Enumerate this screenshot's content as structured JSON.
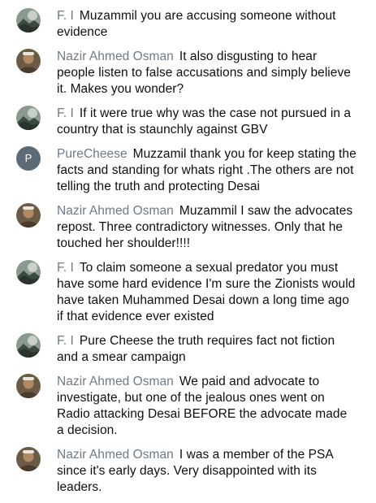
{
  "comments": [
    {
      "author": "F. I",
      "avatar": "landscape-avatar-icon",
      "text": "Muzammil you are accusing someone without evidence"
    },
    {
      "author": "Nazir Ahmed Osman",
      "avatar": "photo-avatar-icon",
      "text": "It also disgusting to hear people listen to false accusations and simply believe it. Makes you wonder?"
    },
    {
      "author": "F. I",
      "avatar": "landscape-avatar-icon",
      "text": "If it were true why was the case not pursued in a country that is staunchly against GBV"
    },
    {
      "author": "PureCheese",
      "avatar": "letter-avatar",
      "avatar_letter": "P",
      "text": "Muzzamil thank you for keep stating the facts and standing for whats right .The others are not telling the truth and protecting Desai"
    },
    {
      "author": "Nazir Ahmed Osman",
      "avatar": "photo-avatar-icon",
      "text": "Muzammil I saw the advocates repost. Three contradictory witnesses. Only that he touched her shoulder!!!!"
    },
    {
      "author": "F. I",
      "avatar": "landscape-avatar-icon",
      "text": "To claim someone a sexual predator you must have some hard evidence I'm sure the Zionists would have taken Muhammed Desai down a long time ago if that evidence ever existed"
    },
    {
      "author": "F. I",
      "avatar": "landscape-avatar-icon",
      "text": "Pure Cheese the truth requires fact not fiction and a smear campaign"
    },
    {
      "author": "Nazir Ahmed Osman",
      "avatar": "photo-avatar-icon",
      "text": "We paid and advocate to investigate, but one of the jealous ones went on Radio attacking Desai BEFORE the advocate made a decision."
    },
    {
      "author": "Nazir Ahmed Osman",
      "avatar": "photo-avatar-icon",
      "text": "I was a member of the PSA since it's early days. Very disappointed with its leaders."
    }
  ]
}
